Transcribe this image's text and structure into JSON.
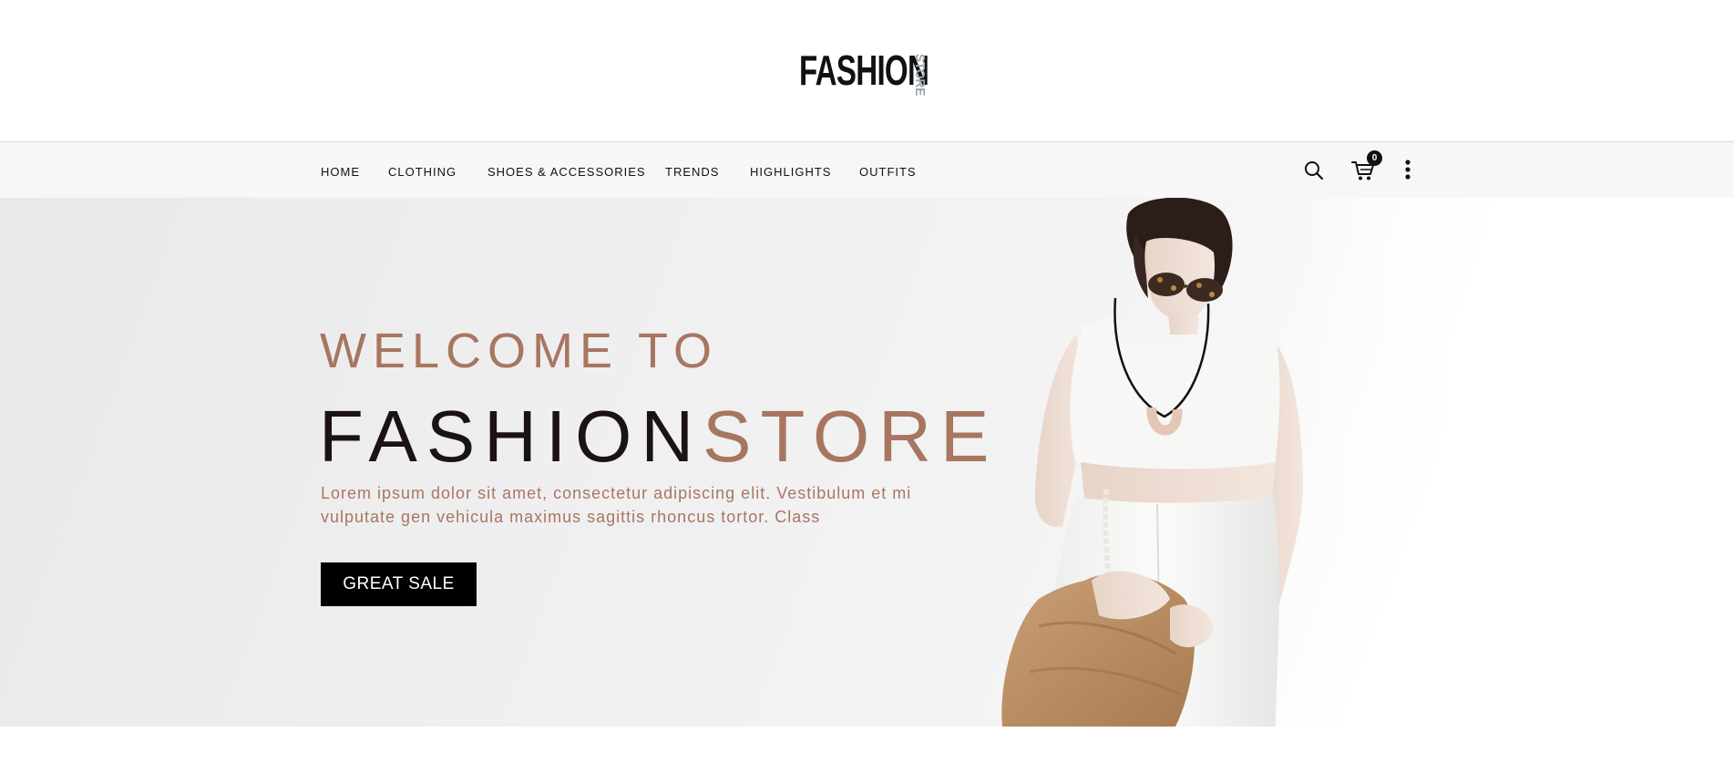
{
  "logo": {
    "main": "FASHION",
    "side": "STORE"
  },
  "nav": {
    "items": [
      {
        "label": "HOME"
      },
      {
        "label": "CLOTHING"
      },
      {
        "label": "SHOES & ACCESSORIES"
      },
      {
        "label": "TRENDS"
      },
      {
        "label": "HIGHLIGHTS"
      },
      {
        "label": "OUTFITS"
      }
    ],
    "cart_count": "0",
    "icons": [
      "search-icon",
      "cart-icon",
      "more-vertical-icon"
    ]
  },
  "hero": {
    "welcome": "WELCOME TO",
    "brand_dark": "FASHION",
    "brand_accent": "STORE",
    "text": "Lorem ipsum dolor sit amet, consectetur adipiscing elit. Vestibulum et mi vulputate gen vehicula maximus sagittis rhoncus tortor. Class",
    "button_label": "GREAT SALE"
  },
  "colors": {
    "accent": "#a87660",
    "dark": "#1b1212",
    "button": "#000000",
    "nav_bg": "#f7f7f7"
  }
}
